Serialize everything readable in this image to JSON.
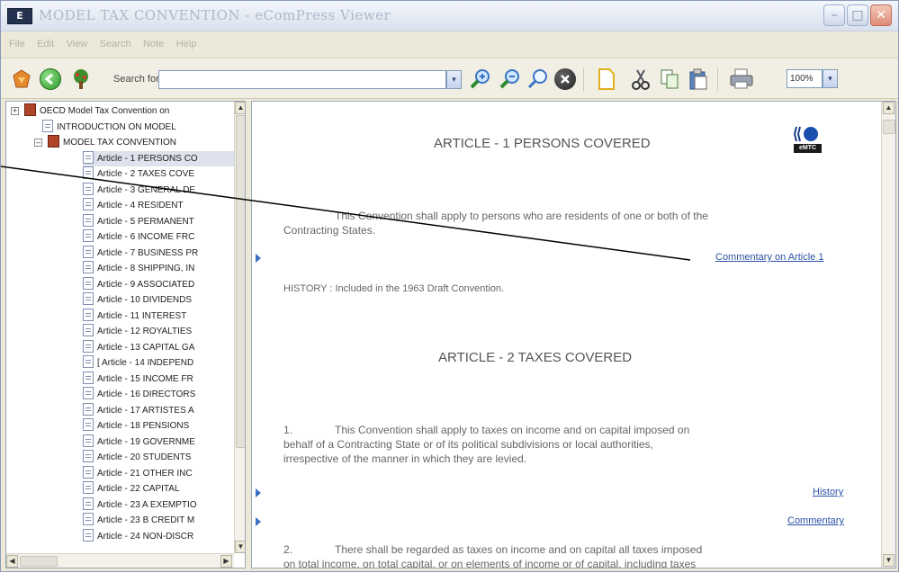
{
  "window": {
    "title": "MODEL TAX CONVENTION - eComPress Viewer",
    "icon_text": "E",
    "controls": {
      "minimize": "–",
      "maximize": "□",
      "close": "✕"
    }
  },
  "menu": [
    "File",
    "Edit",
    "View",
    "Search",
    "Note",
    "Help"
  ],
  "toolbar": {
    "search_label": "Search for",
    "search_value": "",
    "dropdown_glyph": "▾",
    "zoom_value": "100%",
    "icons": [
      "home-icon",
      "back-icon",
      "tree-icon",
      "zoom-in-icon",
      "zoom-out-icon",
      "find-icon",
      "stop-icon",
      "new-document-icon",
      "cut-icon",
      "copy-icon",
      "paste-icon",
      "print-icon"
    ]
  },
  "tree": {
    "items": [
      {
        "label": "OECD Model Tax Convention on",
        "kind": "root",
        "expander": "+"
      },
      {
        "label": "INTRODUCTION ON MODEL",
        "kind": "doc"
      },
      {
        "label": "MODEL TAX CONVENTION",
        "kind": "book",
        "expander": "–"
      },
      {
        "label": "Article - 1 PERSONS CO",
        "kind": "doc",
        "selected": true
      },
      {
        "label": "Article - 2 TAXES COVE",
        "kind": "doc"
      },
      {
        "label": "Article - 3 GENERAL DE",
        "kind": "doc"
      },
      {
        "label": "Article - 4 RESIDENT",
        "kind": "doc"
      },
      {
        "label": "Article - 5 PERMANENT",
        "kind": "doc"
      },
      {
        "label": "Article - 6 INCOME FRC",
        "kind": "doc"
      },
      {
        "label": "Article - 7 BUSINESS PR",
        "kind": "doc"
      },
      {
        "label": "Article - 8 SHIPPING, IN",
        "kind": "doc"
      },
      {
        "label": "Article - 9 ASSOCIATED",
        "kind": "doc"
      },
      {
        "label": "Article - 10 DIVIDENDS",
        "kind": "doc"
      },
      {
        "label": "Article - 11 INTEREST",
        "kind": "doc"
      },
      {
        "label": "Article - 12 ROYALTIES",
        "kind": "doc"
      },
      {
        "label": "Article - 13 CAPITAL GA",
        "kind": "doc"
      },
      {
        "label": "[ Article - 14 INDEPEND",
        "kind": "doc"
      },
      {
        "label": "Article - 15 INCOME FR",
        "kind": "doc"
      },
      {
        "label": "Article - 16 DIRECTORS",
        "kind": "doc"
      },
      {
        "label": "Article - 17 ARTISTES A",
        "kind": "doc"
      },
      {
        "label": "Article - 18 PENSIONS",
        "kind": "doc"
      },
      {
        "label": "Article - 19 GOVERNME",
        "kind": "doc"
      },
      {
        "label": "Article - 20 STUDENTS",
        "kind": "doc"
      },
      {
        "label": "Article - 21 OTHER INC",
        "kind": "doc"
      },
      {
        "label": "Article - 22 CAPITAL",
        "kind": "doc"
      },
      {
        "label": "Article - 23 A EXEMPTIO",
        "kind": "doc"
      },
      {
        "label": "Article - 23 B CREDIT M",
        "kind": "doc"
      },
      {
        "label": "Article - 24 NON-DISCR",
        "kind": "doc"
      }
    ],
    "scroll": {
      "up": "▲",
      "down": "▼",
      "left": "◀",
      "right": "▶"
    }
  },
  "document": {
    "logo_text": "eMTC",
    "article1_heading": "ARTICLE - 1 PERSONS COVERED",
    "article1_text_line1": "This Convention shall apply to persons who are residents of one or both of the",
    "article1_text_line2": "Contracting States.",
    "commentary_article1": "Commentary on Article 1",
    "history1": "HISTORY : Included in the 1963 Draft Convention.",
    "article2_heading": "ARTICLE - 2 TAXES COVERED",
    "para1_num": "1.",
    "para1_line1": "This Convention shall apply to taxes on income and on capital imposed on",
    "para1_line2": "behalf of a Contracting State or of its political subdivisions or local authorities,",
    "para1_line3": "irrespective of the manner in which they are levied.",
    "history_link": "History",
    "commentary_link": "Commentary",
    "para2_num": "2.",
    "para2_line1": "There shall be regarded as taxes on income and on capital all taxes imposed",
    "para2_line2": "on total income, on total capital, or on elements of income or of capital, including taxes",
    "scroll": {
      "up": "▲",
      "down": "▼"
    }
  }
}
